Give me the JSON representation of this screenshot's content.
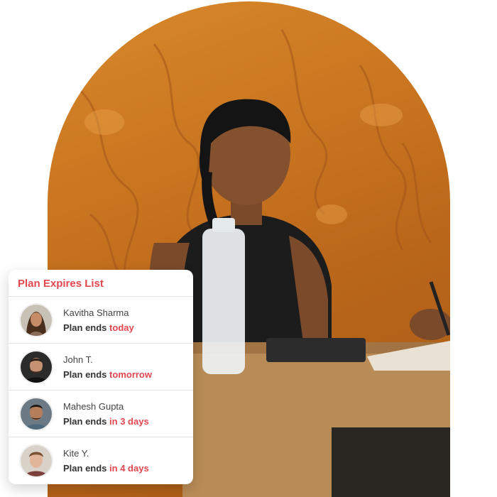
{
  "card": {
    "title": "Plan Expires List",
    "accent": "#e2474f",
    "members": [
      {
        "name": "Kavitha Sharma",
        "plan_prefix": "Plan ends",
        "plan_when": "today",
        "avatar": "woman-avatar"
      },
      {
        "name": "John T.",
        "plan_prefix": "Plan ends",
        "plan_when": "tomorrow",
        "avatar": "bearded-man-avatar"
      },
      {
        "name": "Mahesh Gupta",
        "plan_prefix": "Plan ends",
        "plan_when": "in 3 days",
        "avatar": "man-avatar"
      },
      {
        "name": "Kite Y.",
        "plan_prefix": "Plan ends",
        "plan_when": "in 4 days",
        "avatar": "young-man-avatar"
      }
    ]
  },
  "photo": {
    "description_icon": "gym-reception-photo"
  }
}
